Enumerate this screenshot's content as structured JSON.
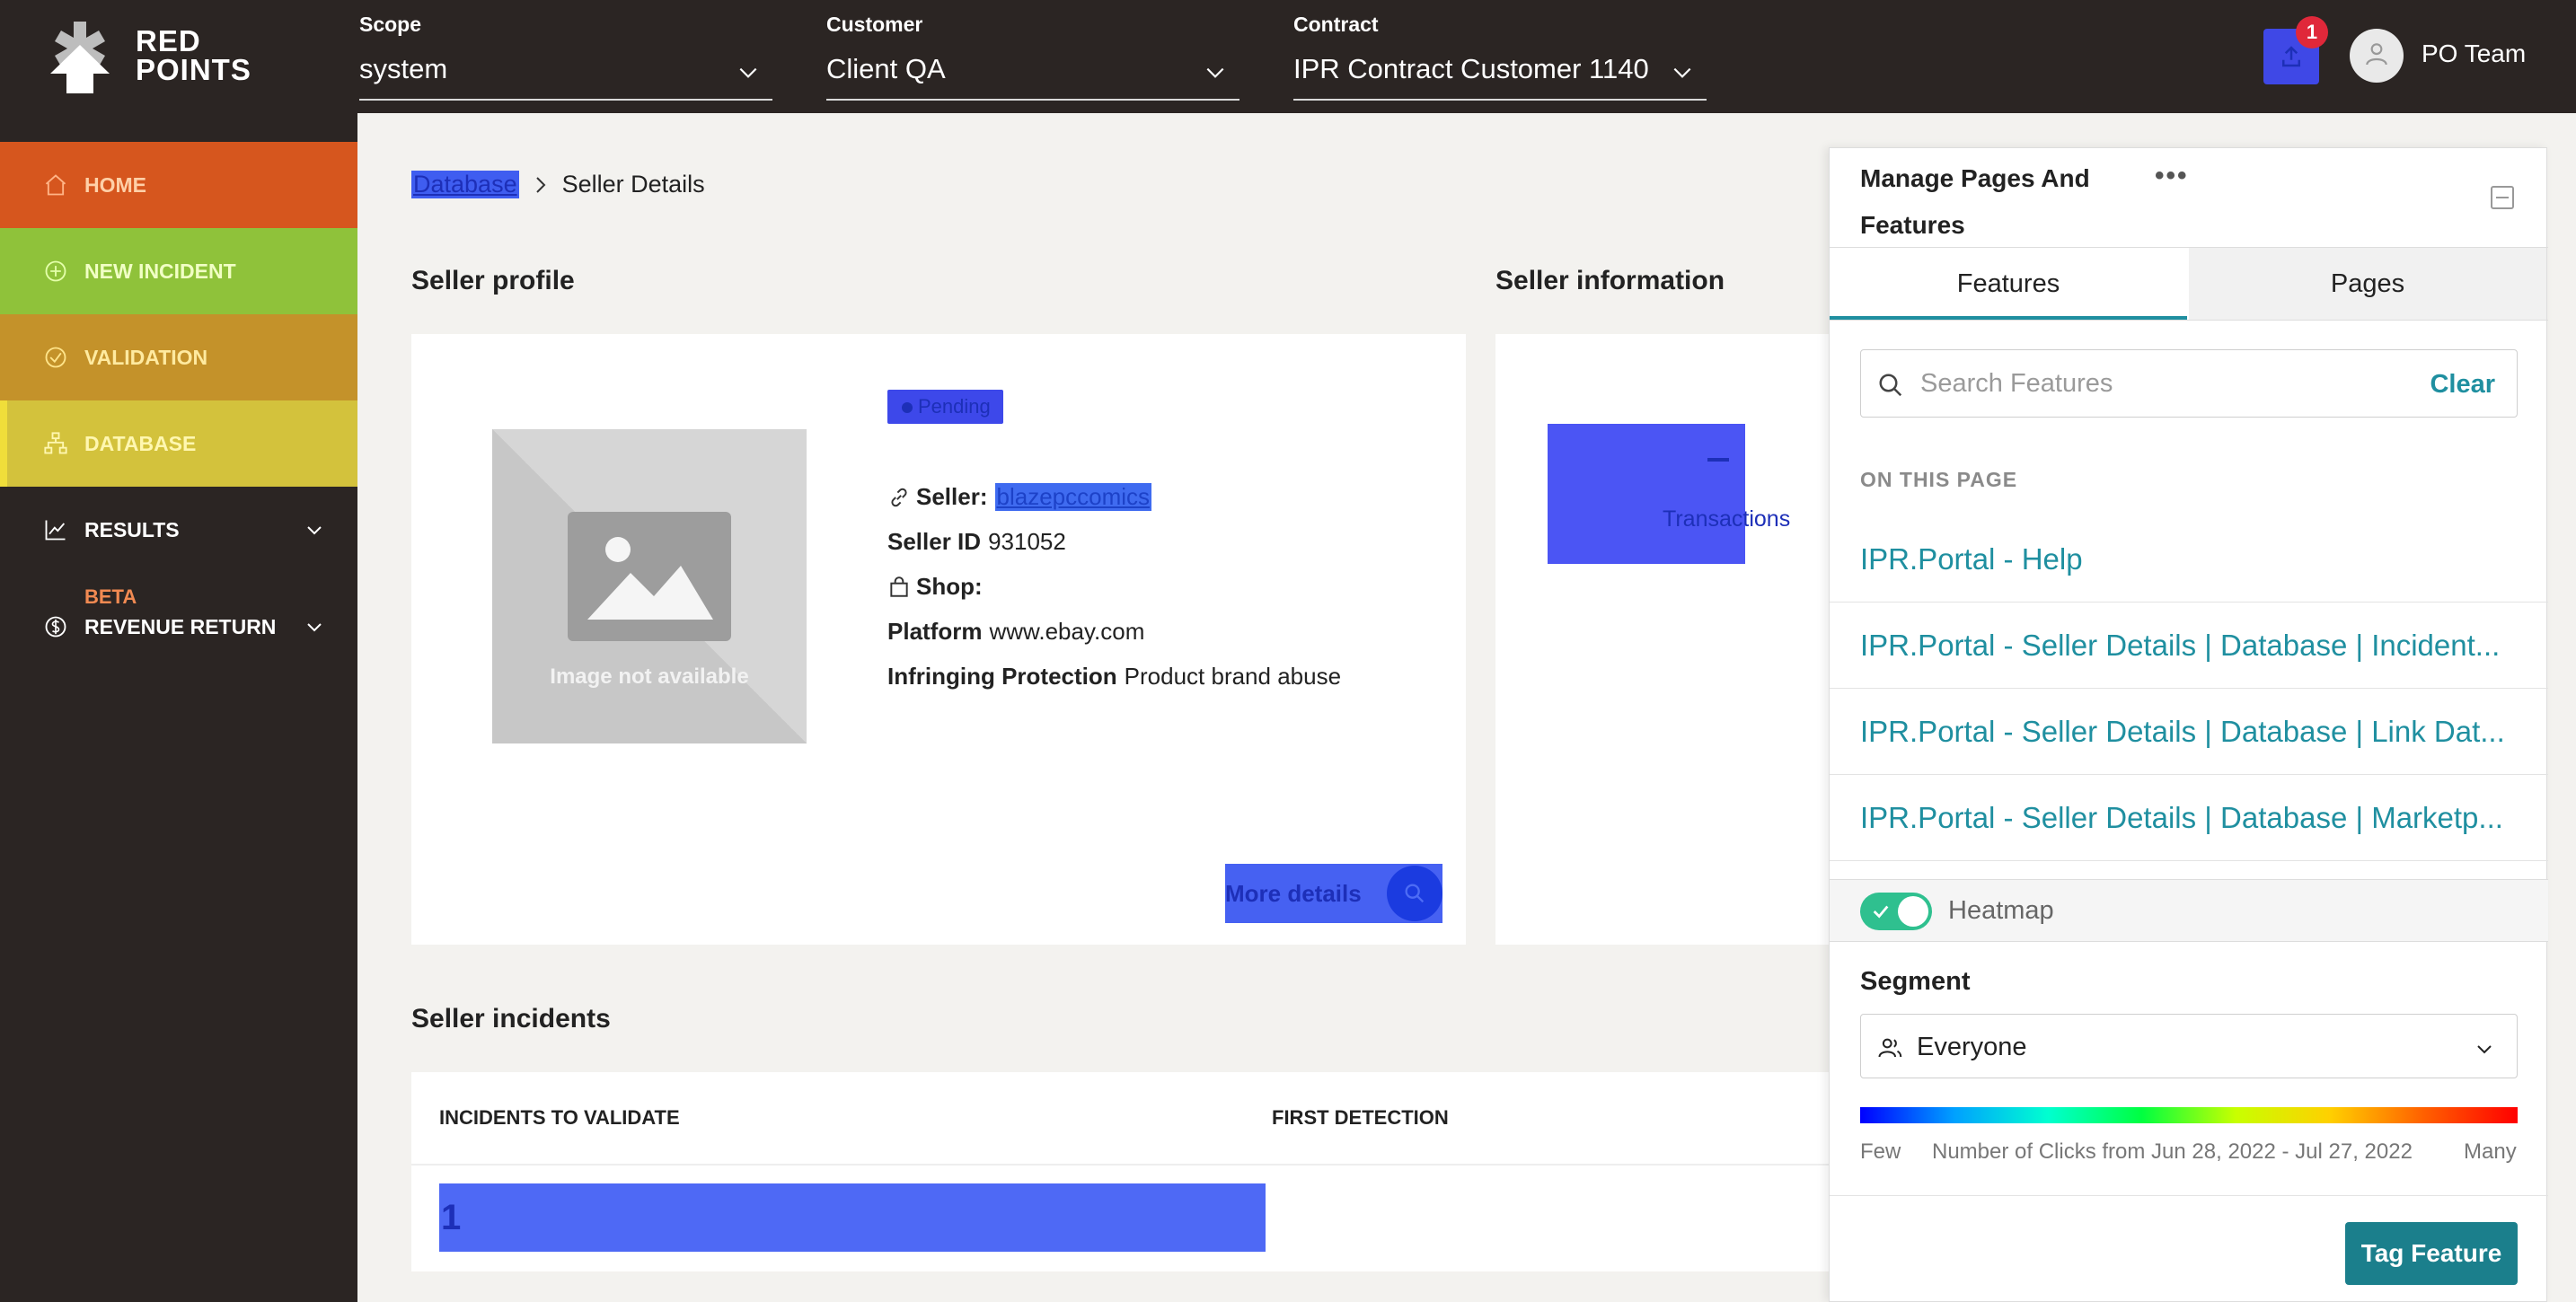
{
  "header": {
    "logo": "RED POINTS",
    "scope": {
      "label": "Scope",
      "value": "system"
    },
    "customer": {
      "label": "Customer",
      "value": "Client QA"
    },
    "contract": {
      "label": "Contract",
      "value": "IPR Contract Customer 1140"
    },
    "notification_count": "1",
    "user_name": "PO Team"
  },
  "sidebar": {
    "items": [
      {
        "label": "HOME",
        "icon": "home-icon"
      },
      {
        "label": "NEW INCIDENT",
        "icon": "plus-circle-icon"
      },
      {
        "label": "VALIDATION",
        "icon": "check-circle-icon"
      },
      {
        "label": "DATABASE",
        "icon": "hierarchy-icon"
      },
      {
        "label": "RESULTS",
        "icon": "chart-line-icon"
      },
      {
        "label": "REVENUE RETURN",
        "icon": "dollar-circle-icon",
        "badge": "BETA"
      }
    ],
    "colors": {
      "home": "#d6561e",
      "new_incident": "#8fc23a",
      "validation": "#c4922a",
      "database": "#d3c23c"
    }
  },
  "breadcrumb": {
    "parent": "Database",
    "current": "Seller Details"
  },
  "seller_profile": {
    "title": "Seller profile",
    "image_alt": "Image not available",
    "status": "Pending",
    "seller_label": "Seller:",
    "seller_name": "blazepccomics",
    "seller_id_label": "Seller ID",
    "seller_id": "931052",
    "shop_label": "Shop:",
    "shop_value": "",
    "platform_label": "Platform",
    "platform": "www.ebay.com",
    "infringing_label": "Infringing Protection",
    "infringing": "Product brand abuse",
    "more_details": "More details"
  },
  "seller_information": {
    "title": "Seller information",
    "transactions_value": "–",
    "transactions_label": "Transactions"
  },
  "seller_incidents": {
    "title": "Seller incidents",
    "columns": [
      "INCIDENTS TO VALIDATE",
      "FIRST DETECTION"
    ],
    "incidents_to_validate": "1"
  },
  "panel": {
    "title": "Manage Pages And Features",
    "more": "•••",
    "tabs": [
      "Features",
      "Pages"
    ],
    "search_placeholder": "Search Features",
    "clear_label": "Clear",
    "section_label": "ON THIS PAGE",
    "features": [
      "IPR.Portal - Help",
      "IPR.Portal - Seller Details | Database | Incident...",
      "IPR.Portal - Seller Details | Database | Link Dat...",
      "IPR.Portal - Seller Details | Database | Marketp..."
    ],
    "heatmap_label": "Heatmap",
    "heatmap_on": true,
    "segment_label": "Segment",
    "segment_value": "Everyone",
    "legend_few": "Few",
    "legend_range": "Number of Clicks from Jun 28, 2022 - Jul 27, 2022",
    "legend_many": "Many",
    "tag_button": "Tag Feature",
    "accent": "#1f8fa0"
  }
}
